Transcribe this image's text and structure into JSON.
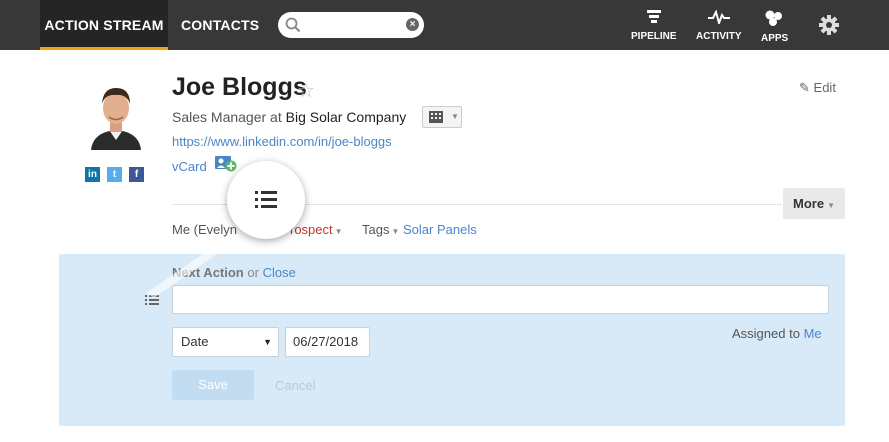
{
  "nav": {
    "tabs": [
      {
        "label": "ACTION STREAM"
      },
      {
        "label": "CONTACTS"
      }
    ],
    "search": {
      "placeholder": "",
      "value": ""
    },
    "icons": [
      {
        "label": "PIPELINE",
        "icon": "pipeline-funnel-icon"
      },
      {
        "label": "ACTIVITY",
        "icon": "activity-pulse-icon"
      },
      {
        "label": "APPS",
        "icon": "apps-icon"
      }
    ],
    "settings_icon": "gear-icon"
  },
  "contact": {
    "name": "Joe Bloggs",
    "star_glyph": "☆",
    "edit_label": "Edit",
    "job_title_prefix": "Sales Manager at",
    "company": "Big Solar Company",
    "linkedin_url": "https://www.linkedin.com/in/joe-bloggs",
    "vcard_label": "vCard",
    "social": [
      "in",
      "t",
      "f"
    ]
  },
  "actions": {
    "more_label": "More"
  },
  "meta": {
    "owner_partial": "Me (Evelyn",
    "status_partial": "rospect",
    "tags_label": "Tags",
    "tag_value": "Solar Panels"
  },
  "next_action": {
    "title": "Next Action",
    "or_text": "or",
    "close_label": "Close",
    "input_value": "",
    "date_type": "Date",
    "date_value": "06/27/2018",
    "assigned_label": "Assigned to",
    "assigned_value": "Me",
    "save_label": "Save",
    "cancel_label": "Cancel"
  },
  "colors": {
    "topbar": "#383838",
    "active_accent": "#f0a30a",
    "link": "#4a86c8",
    "panel": "#d8eaf8",
    "prospect": "#c0392b"
  }
}
